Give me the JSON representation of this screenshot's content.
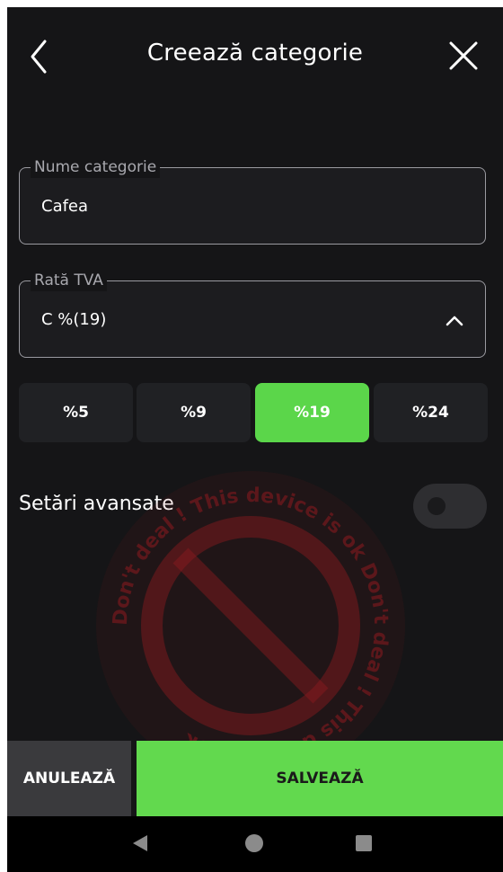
{
  "header": {
    "title": "Creează categorie",
    "back_icon": "chevron-left-icon",
    "close_icon": "close-icon"
  },
  "form": {
    "name_field": {
      "label": "Nume categorie",
      "value": "Cafea"
    },
    "vat_field": {
      "label": "Rată TVA",
      "value": "C %(19)",
      "icon": "chevron-up-icon"
    }
  },
  "vat_options": [
    {
      "label": "%5",
      "selected": false
    },
    {
      "label": "%9",
      "selected": false
    },
    {
      "label": "%19",
      "selected": true
    },
    {
      "label": "%24",
      "selected": false
    }
  ],
  "advanced": {
    "label": "Setări avansate",
    "enabled": false
  },
  "watermark": {
    "text": "Don't deal ! This device is ok Don't deal ! This device is ok",
    "color": "#8e1a1f"
  },
  "actions": {
    "cancel": "ANULEAZĂ",
    "save": "SALVEAZĂ"
  },
  "colors": {
    "accent": "#5bd64a",
    "background": "#151517",
    "chip": "#202124"
  },
  "system_nav": {
    "back": "nav-back-icon",
    "home": "nav-home-icon",
    "recent": "nav-recent-icon"
  }
}
